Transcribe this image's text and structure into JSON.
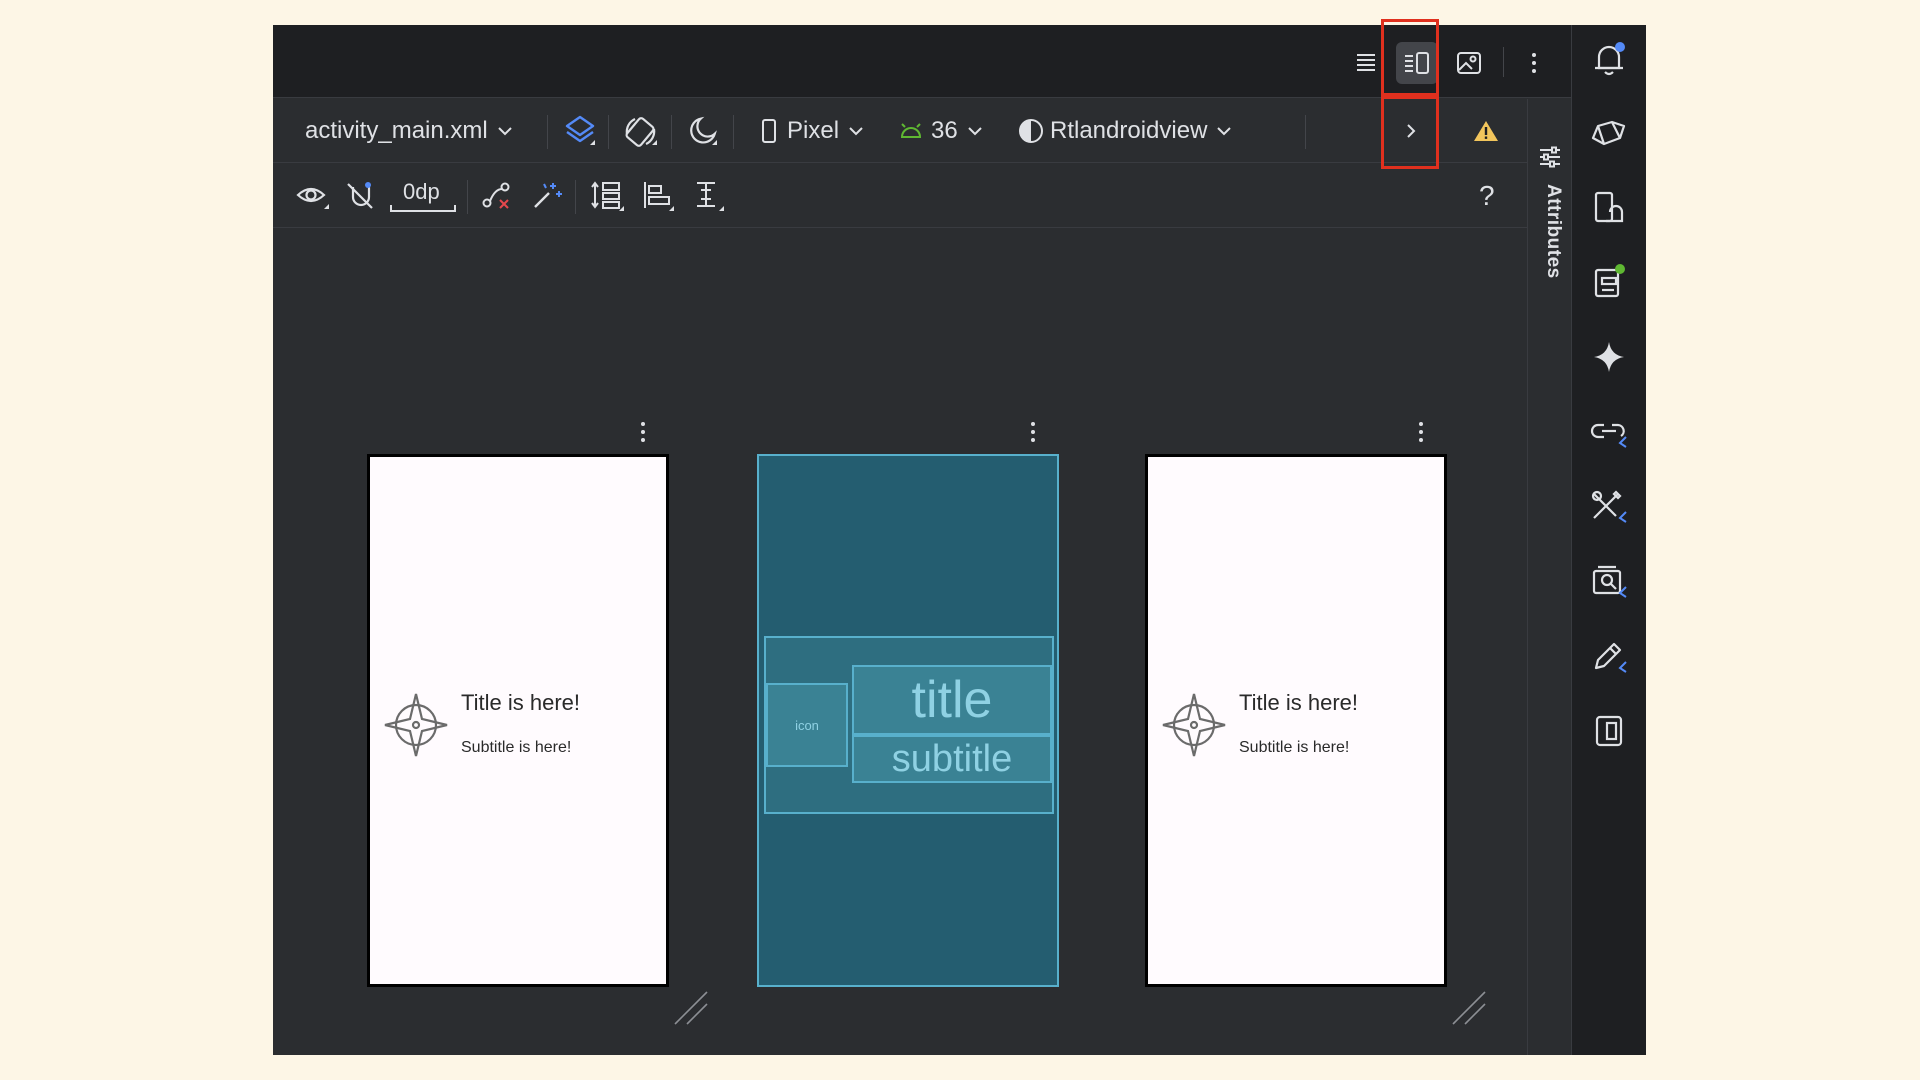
{
  "toolbar": {
    "file_name": "activity_main.xml",
    "device": "Pixel",
    "api_level": "36",
    "theme": "Rtlandroidview",
    "margin_value": "0dp",
    "help": "?"
  },
  "attributes_panel": {
    "label": "Attributes"
  },
  "previews": {
    "left": {
      "title": "Title is here!",
      "subtitle": "Subtitle is here!"
    },
    "blueprint": {
      "icon": "icon",
      "title": "title",
      "subtitle": "subtitle"
    },
    "right": {
      "title": "Title is here!",
      "subtitle": "Subtitle is here!"
    }
  },
  "colors": {
    "background": "#fdf6e6",
    "ide": "#2b2d30",
    "accent_blue": "#548af7",
    "android_green": "#5fb832",
    "warning": "#f2c55c",
    "highlight": "#e0301e",
    "blueprint": "#245d70"
  },
  "icons": {
    "view_modes": [
      "code-view-icon",
      "split-view-icon",
      "design-view-icon"
    ],
    "right_bar": [
      "notifications-icon",
      "gemini-chat-icon",
      "device-manager-icon",
      "running-devices-icon",
      "ai-sparkle-icon",
      "link-icon",
      "tools-icon",
      "layout-inspector-icon",
      "edit-icon",
      "device-mirroring-icon"
    ]
  }
}
